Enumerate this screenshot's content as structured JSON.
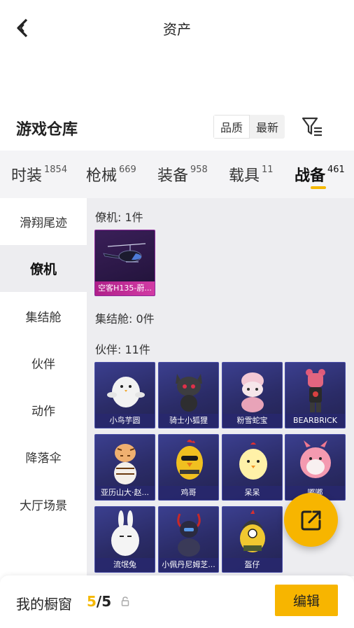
{
  "header": {
    "title": "资产"
  },
  "warehouse": {
    "title": "游戏仓库",
    "sort_options": [
      "品质",
      "最新"
    ],
    "active_sort": "品质"
  },
  "tabs": [
    {
      "label": "时装",
      "count": "1854"
    },
    {
      "label": "枪械",
      "count": "669"
    },
    {
      "label": "装备",
      "count": "958"
    },
    {
      "label": "载具",
      "count": "11"
    },
    {
      "label": "战备",
      "count": "461",
      "active": true
    }
  ],
  "sidebar": {
    "items": [
      {
        "label": "滑翔尾迹"
      },
      {
        "label": "僚机",
        "active": true
      },
      {
        "label": "集结舱"
      },
      {
        "label": "伙伴"
      },
      {
        "label": "动作"
      },
      {
        "label": "降落伞"
      },
      {
        "label": "大厅场景"
      }
    ]
  },
  "sections": {
    "wingman": {
      "title": "僚机: 1件",
      "items": [
        {
          "name": "空客H135-蔚..."
        }
      ]
    },
    "pod": {
      "title": "集结舱: 0件"
    },
    "partner": {
      "title": "伙伴: 11件",
      "items": [
        {
          "name": "小鸟芋圆"
        },
        {
          "name": "骑士小狐狸"
        },
        {
          "name": "粉雪蛇宝"
        },
        {
          "name": "BEARBRICK"
        },
        {
          "name": "亚历山大·赵..."
        },
        {
          "name": "鸡哥"
        },
        {
          "name": "呆呆"
        },
        {
          "name": "嘟嘟"
        },
        {
          "name": "流氓兔"
        },
        {
          "name": "小佩丹尼姆芝..."
        },
        {
          "name": "盔仔"
        }
      ]
    }
  },
  "bottom": {
    "shelf_label": "我的橱窗",
    "shelf_current": "5",
    "shelf_total": "/5",
    "edit_label": "编辑"
  },
  "colors": {
    "accent": "#f7b500",
    "card_blue": "#2b2c68",
    "card_epic": "#b0208a"
  }
}
